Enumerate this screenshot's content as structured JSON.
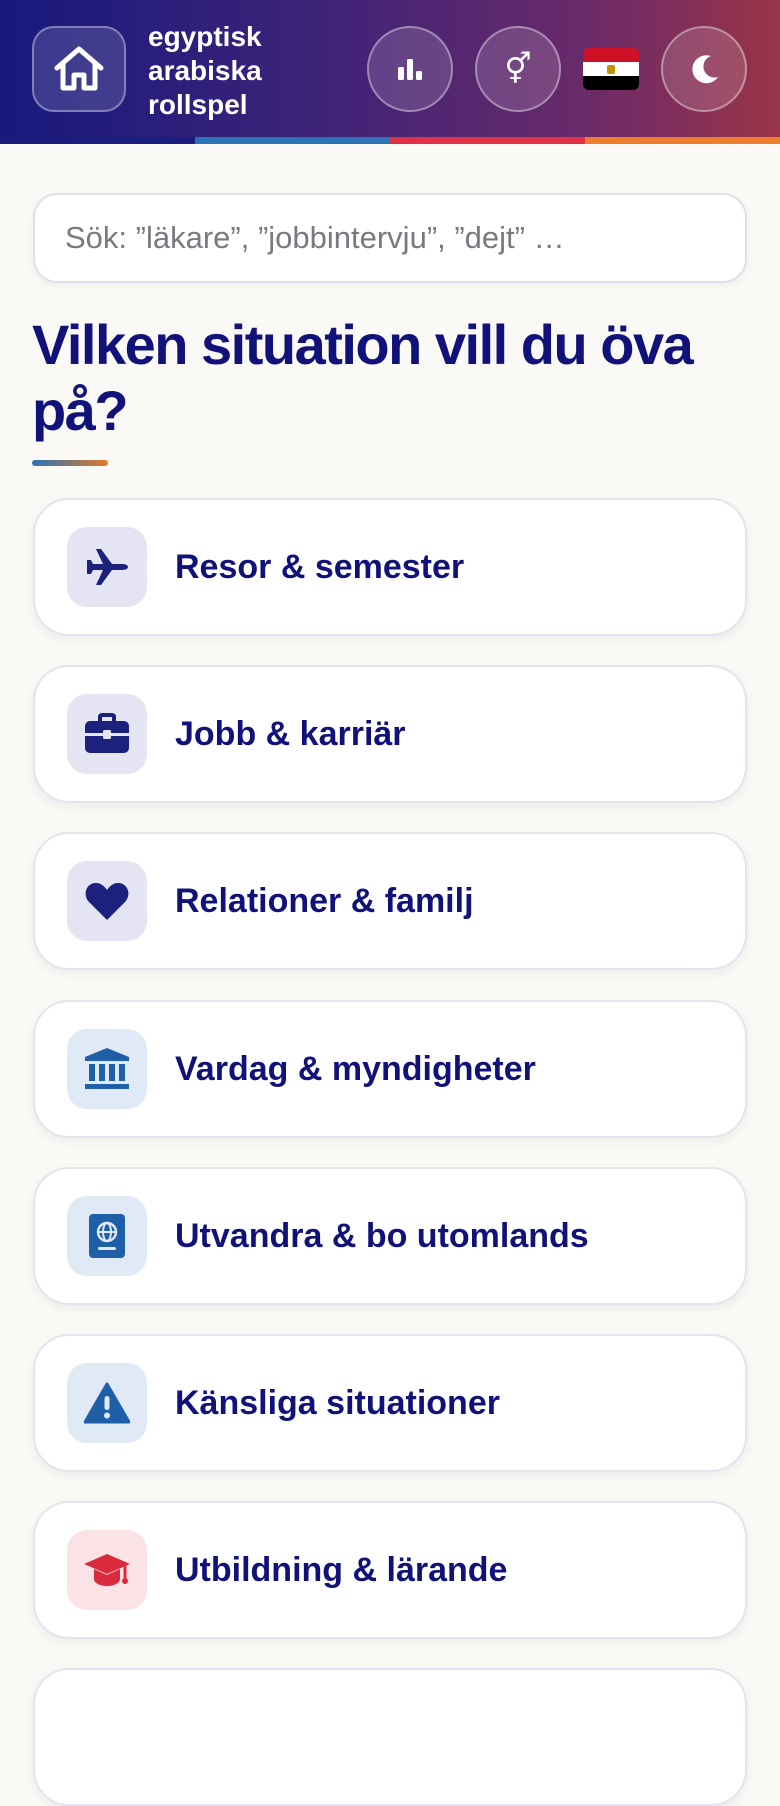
{
  "header": {
    "title_lines": [
      "egyptisk",
      "arabiska",
      "rollspel"
    ],
    "buttons": [
      {
        "icon": "home-icon"
      },
      {
        "icon": "bar-chart-icon"
      },
      {
        "icon": "gender-icon",
        "glyph": "⚥"
      },
      {
        "icon": "egypt-flag-icon"
      },
      {
        "icon": "moon-icon"
      }
    ],
    "stripe_colors": [
      "#17197e",
      "#2b74b6",
      "#e03247",
      "#ef7d2e"
    ]
  },
  "search": {
    "placeholder": "Sök: ”läkare”, ”jobbintervju”, ”dejt” …"
  },
  "main": {
    "heading": "Vilken situation vill du öva på?"
  },
  "categories": [
    {
      "label": "Resor & semester",
      "icon": "airplane-icon",
      "icon_bg": "#e4e4f2",
      "icon_color": "#1d217e"
    },
    {
      "label": "Jobb & karriär",
      "icon": "briefcase-icon",
      "icon_bg": "#e4e4f2",
      "icon_color": "#1d217e"
    },
    {
      "label": "Relationer & familj",
      "icon": "heart-icon",
      "icon_bg": "#e4e4f2",
      "icon_color": "#1d217e"
    },
    {
      "label": "Vardag & myndigheter",
      "icon": "bank-icon",
      "icon_bg": "#dfeaf6",
      "icon_color": "#1f5fa8"
    },
    {
      "label": "Utvandra & bo utomlands",
      "icon": "passport-icon",
      "icon_bg": "#dfeaf6",
      "icon_color": "#1f5fa8"
    },
    {
      "label": "Känsliga situationer",
      "icon": "warning-icon",
      "icon_bg": "#dfeaf6",
      "icon_color": "#1f5fa8"
    },
    {
      "label": "Utbildning & lärande",
      "icon": "graduation-cap-icon",
      "icon_bg": "#fbe2e6",
      "icon_color": "#d92b3d"
    }
  ],
  "colors": {
    "heading": "#10127a",
    "background": "#faf9f5",
    "header_gradient_start": "#17197e",
    "header_gradient_end": "#9a3448"
  }
}
